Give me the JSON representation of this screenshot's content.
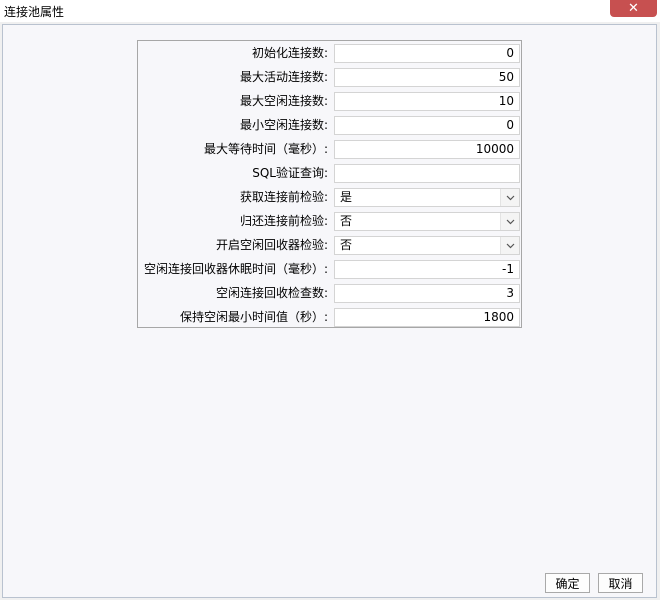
{
  "window": {
    "title": "连接池属性",
    "close_glyph": "✕"
  },
  "form": {
    "rows": [
      {
        "label": "初始化连接数:",
        "value": "0",
        "type": "text"
      },
      {
        "label": "最大活动连接数:",
        "value": "50",
        "type": "text"
      },
      {
        "label": "最大空闲连接数:",
        "value": "10",
        "type": "text"
      },
      {
        "label": "最小空闲连接数:",
        "value": "0",
        "type": "text"
      },
      {
        "label": "最大等待时间（毫秒）:",
        "value": "10000",
        "type": "text"
      },
      {
        "label": "SQL验证查询:",
        "value": "",
        "type": "text"
      },
      {
        "label": "获取连接前检验:",
        "value": "是",
        "type": "select"
      },
      {
        "label": "归还连接前检验:",
        "value": "否",
        "type": "select"
      },
      {
        "label": "开启空闲回收器检验:",
        "value": "否",
        "type": "select"
      },
      {
        "label": "空闲连接回收器休眠时间（毫秒）:",
        "value": "-1",
        "type": "text"
      },
      {
        "label": "空闲连接回收检查数:",
        "value": "3",
        "type": "text"
      },
      {
        "label": "保持空闲最小时间值（秒）:",
        "value": "1800",
        "type": "text"
      }
    ]
  },
  "buttons": {
    "ok": "确定",
    "cancel": "取消"
  },
  "colors": {
    "close_button": "#c75050",
    "dialog_bg": "#f7f7fa",
    "border": "#a7a7a7"
  }
}
